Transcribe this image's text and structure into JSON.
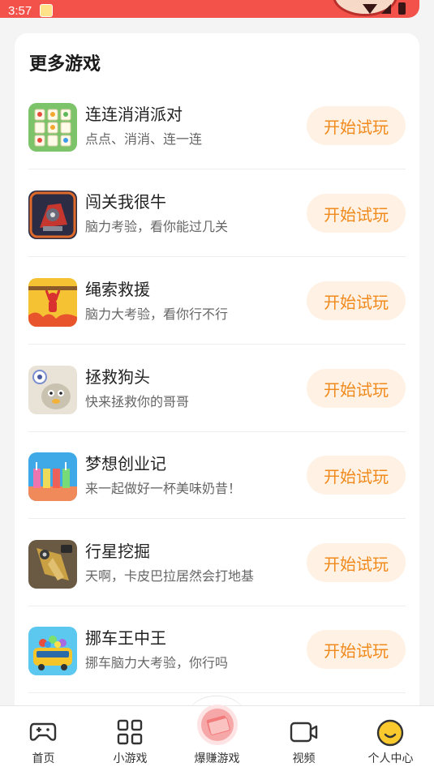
{
  "status_bar": {
    "time": "3:57"
  },
  "section_title": "更多游戏",
  "games": [
    {
      "name": "连连消消派对",
      "desc": "点点、消消、连一连",
      "button": "开始试玩",
      "icon": "tile-match-icon",
      "icon_color": "#7cc36a"
    },
    {
      "name": "闯关我很牛",
      "desc": "脑力考验，看你能过几关",
      "button": "开始试玩",
      "icon": "robot-icon",
      "icon_color": "#2c2c44"
    },
    {
      "name": "绳索救援",
      "desc": "脑力大考验，看你行不行",
      "button": "开始试玩",
      "icon": "rope-rescue-icon",
      "icon_color": "#f4c233"
    },
    {
      "name": "拯救狗头",
      "desc": "快来拯救你的哥哥",
      "button": "开始试玩",
      "icon": "doge-icon",
      "icon_color": "#e8e3d6"
    },
    {
      "name": "梦想创业记",
      "desc": "来一起做好一杯美味奶昔！",
      "button": "开始试玩",
      "icon": "milkshake-icon",
      "icon_color": "#3fa9e8"
    },
    {
      "name": "行星挖掘",
      "desc": "天啊，卡皮巴拉居然会打地基",
      "button": "开始试玩",
      "icon": "drill-icon",
      "icon_color": "#c9a043"
    },
    {
      "name": "挪车王中王",
      "desc": "挪车脑力大考验，你行吗",
      "button": "开始试玩",
      "icon": "bus-icon",
      "icon_color": "#5cc8f0"
    }
  ],
  "nav": [
    {
      "label": "首页",
      "icon": "gamepad-icon"
    },
    {
      "label": "小游戏",
      "icon": "grid-icon"
    },
    {
      "label": "爆赚游戏",
      "icon": "money-icon"
    },
    {
      "label": "视频",
      "icon": "video-camera-icon"
    },
    {
      "label": "个人中心",
      "icon": "smiley-icon"
    }
  ],
  "colors": {
    "banner": "#f3524a",
    "button_bg": "#fff1e3",
    "button_text": "#f08a1c"
  }
}
